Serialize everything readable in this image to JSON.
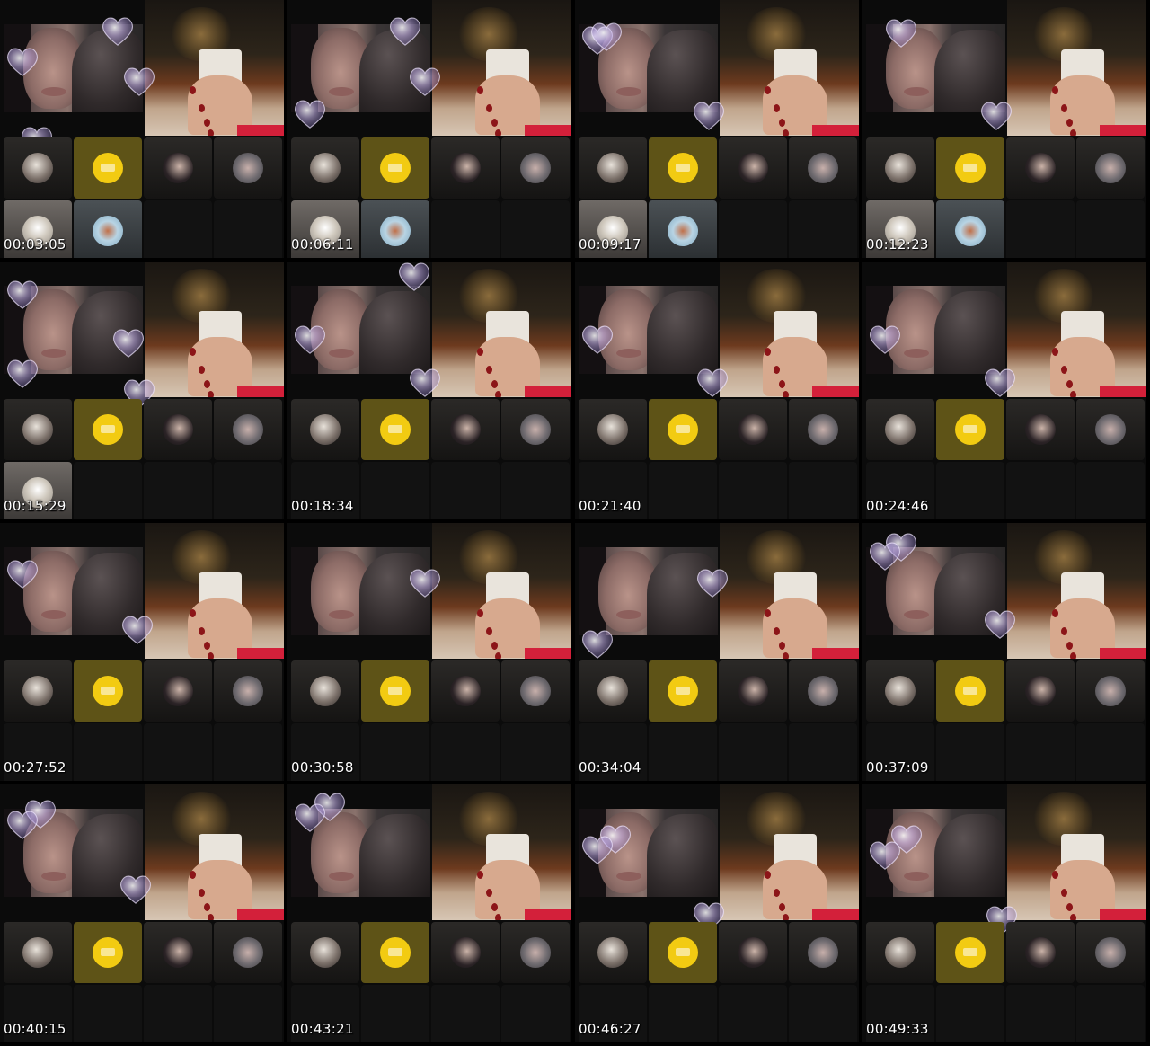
{
  "contact_sheet": {
    "columns": 4,
    "rows": 4,
    "frames": [
      {
        "timestamp": "00:03:05",
        "extra_cells": [
          "light",
          "blue"
        ]
      },
      {
        "timestamp": "00:06:11",
        "extra_cells": [
          "light",
          "blue"
        ]
      },
      {
        "timestamp": "00:09:17",
        "extra_cells": [
          "light",
          "blue"
        ]
      },
      {
        "timestamp": "00:12:23",
        "extra_cells": [
          "light",
          "blue"
        ]
      },
      {
        "timestamp": "00:15:29",
        "extra_cells": [
          "light"
        ]
      },
      {
        "timestamp": "00:18:34",
        "extra_cells": []
      },
      {
        "timestamp": "00:21:40",
        "extra_cells": []
      },
      {
        "timestamp": "00:24:46",
        "extra_cells": []
      },
      {
        "timestamp": "00:27:52",
        "extra_cells": []
      },
      {
        "timestamp": "00:30:58",
        "extra_cells": []
      },
      {
        "timestamp": "00:34:04",
        "extra_cells": []
      },
      {
        "timestamp": "00:37:09",
        "extra_cells": []
      },
      {
        "timestamp": "00:40:15",
        "extra_cells": []
      },
      {
        "timestamp": "00:43:21",
        "extra_cells": []
      },
      {
        "timestamp": "00:46:27",
        "extra_cells": []
      },
      {
        "timestamp": "00:49:33",
        "extra_cells": []
      }
    ]
  },
  "participant_avatars": [
    "a1",
    "a2",
    "a3",
    "a4"
  ],
  "extra_avatars": {
    "light": "a5",
    "blue": "a6"
  },
  "colors": {
    "background": "#000000",
    "highlight_cell": "#5e5317",
    "heart_tint": "#c8b4f0",
    "sticker": "#d3203a"
  },
  "icons": {
    "heart": "heart-bubble-icon"
  }
}
